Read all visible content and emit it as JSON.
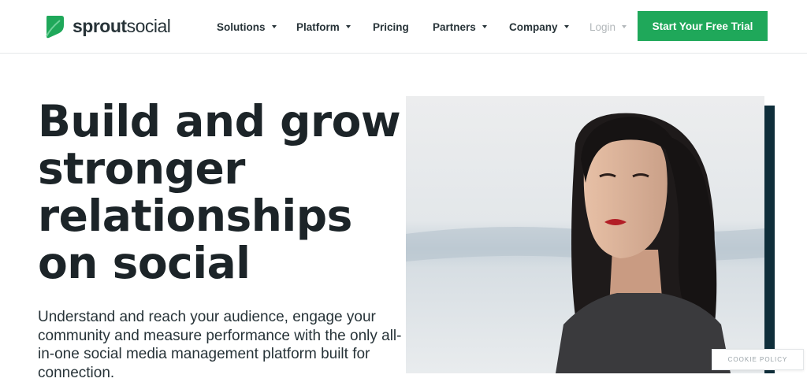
{
  "brand": {
    "name_bold": "sprout",
    "name_light": "social",
    "color": "#1fa85a"
  },
  "nav": {
    "items": [
      {
        "label": "Solutions",
        "has_caret": true
      },
      {
        "label": "Platform",
        "has_caret": true
      },
      {
        "label": "Pricing",
        "has_caret": false
      },
      {
        "label": "Partners",
        "has_caret": true
      },
      {
        "label": "Company",
        "has_caret": true
      },
      {
        "label": "Login",
        "has_caret": true
      }
    ],
    "cta_label": "Start Your Free Trial"
  },
  "hero": {
    "headline": "Build and grow stronger relationships on social",
    "subcopy": "Understand and reach your audience, engage your community and measure performance with the only all-in-one social media management platform built for connection.",
    "accent_color": "#0f2e3a"
  },
  "cookie": {
    "label": "COOKIE POLICY"
  }
}
